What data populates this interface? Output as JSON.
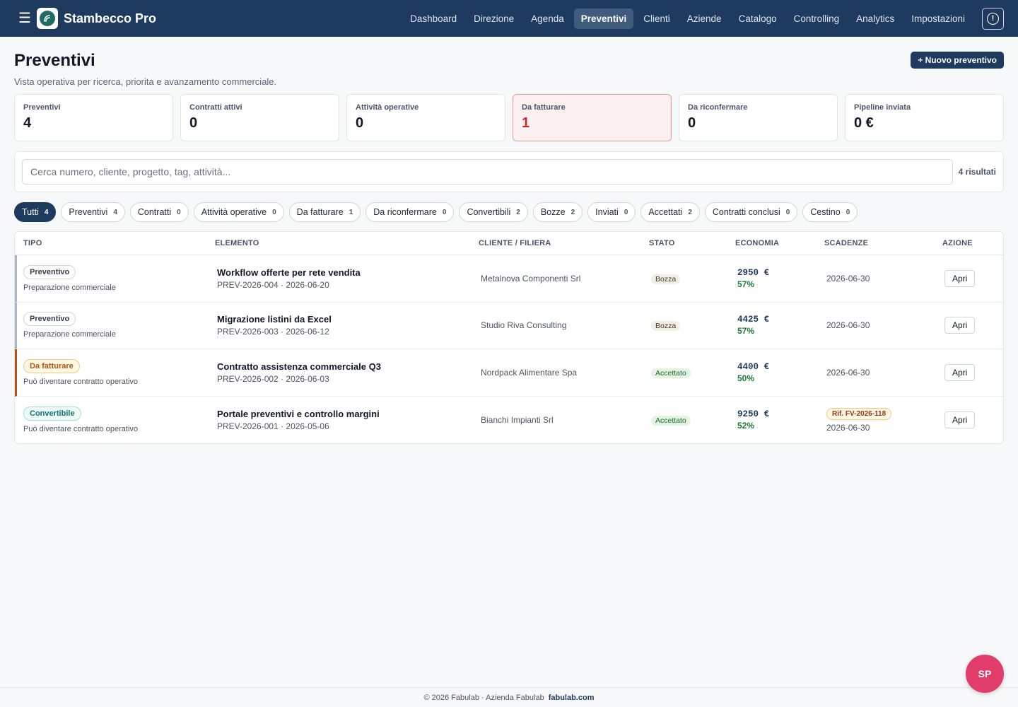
{
  "app": {
    "name": "Stambecco Pro",
    "nav": [
      "Dashboard",
      "Direzione",
      "Agenda",
      "Preventivi",
      "Clienti",
      "Aziende",
      "Catalogo",
      "Controlling",
      "Analytics",
      "Impostazioni"
    ],
    "active_nav": "Preventivi",
    "alert_icon": "!"
  },
  "header": {
    "title": "Preventivi",
    "subtitle": "Vista operativa per ricerca, priorita e avanzamento commerciale.",
    "new_button": "+ Nuovo preventivo"
  },
  "kpis": [
    {
      "label": "Preventivi",
      "value": "4",
      "alert": false
    },
    {
      "label": "Contratti attivi",
      "value": "0",
      "alert": false
    },
    {
      "label": "Attività operative",
      "value": "0",
      "alert": false
    },
    {
      "label": "Da fatturare",
      "value": "1",
      "alert": true
    },
    {
      "label": "Da riconfermare",
      "value": "0",
      "alert": false
    },
    {
      "label": "Pipeline inviata",
      "value": "0 €",
      "alert": false
    }
  ],
  "search": {
    "placeholder": "Cerca numero, cliente, progetto, tag, attività...",
    "results": "4 risultati"
  },
  "filters": [
    {
      "label": "Tutti",
      "count": "4",
      "active": true
    },
    {
      "label": "Preventivi",
      "count": "4",
      "active": false
    },
    {
      "label": "Contratti",
      "count": "0",
      "active": false
    },
    {
      "label": "Attività operative",
      "count": "0",
      "active": false
    },
    {
      "label": "Da fatturare",
      "count": "1",
      "active": false
    },
    {
      "label": "Da riconfermare",
      "count": "0",
      "active": false
    },
    {
      "label": "Convertibili",
      "count": "2",
      "active": false
    },
    {
      "label": "Bozze",
      "count": "2",
      "active": false
    },
    {
      "label": "Inviati",
      "count": "0",
      "active": false
    },
    {
      "label": "Accettati",
      "count": "2",
      "active": false
    },
    {
      "label": "Contratti conclusi",
      "count": "0",
      "active": false
    },
    {
      "label": "Cestino",
      "count": "0",
      "active": false
    }
  ],
  "table": {
    "columns": [
      "TIPO",
      "ELEMENTO",
      "CLIENTE / FILIERA",
      "STATO",
      "ECONOMIA",
      "SCADENZE",
      "AZIONE"
    ],
    "rows": [
      {
        "tipo": "Preventivo",
        "tipo_style": "default",
        "tipo_sub": "Preparazione commerciale",
        "title": "Workflow offerte per rete vendita",
        "sub": "PREV-2026-004 · 2026-06-20",
        "client": "Metalnova Componenti Srl",
        "state": "Bozza",
        "state_style": "draft",
        "amount": "2950 €",
        "pct": "57%",
        "ref": "",
        "due": "2026-06-30",
        "action": "Apri"
      },
      {
        "tipo": "Preventivo",
        "tipo_style": "default",
        "tipo_sub": "Preparazione commerciale",
        "title": "Migrazione listini da Excel",
        "sub": "PREV-2026-003 · 2026-06-12",
        "client": "Studio Riva Consulting",
        "state": "Bozza",
        "state_style": "draft",
        "amount": "4425 €",
        "pct": "57%",
        "ref": "",
        "due": "2026-06-30",
        "action": "Apri"
      },
      {
        "tipo": "Da fatturare",
        "tipo_style": "orange",
        "tipo_sub": "Può diventare contratto operativo",
        "title": "Contratto assistenza commerciale Q3",
        "sub": "PREV-2026-002 · 2026-06-03",
        "client": "Nordpack Alimentare Spa",
        "state": "Accettato",
        "state_style": "ok",
        "amount": "4400 €",
        "pct": "50%",
        "ref": "",
        "due": "2026-06-30",
        "action": "Apri"
      },
      {
        "tipo": "Convertibile",
        "tipo_style": "teal",
        "tipo_sub": "Può diventare contratto operativo",
        "title": "Portale preventivi e controllo margini",
        "sub": "PREV-2026-001 · 2026-05-06",
        "client": "Bianchi Impianti Srl",
        "state": "Accettato",
        "state_style": "ok",
        "amount": "9250 €",
        "pct": "52%",
        "ref": "Rif. FV-2026-118",
        "due": "2026-06-30",
        "action": "Apri"
      }
    ]
  },
  "footer": {
    "text": "© 2026 Fabulab · Azienda Fabulab",
    "link": "fabulab.com"
  },
  "user": {
    "initials": "SP"
  },
  "colors": {
    "brand": "#1e3a5f",
    "alert": "#c52b2b",
    "fab": "#e23d6a"
  }
}
